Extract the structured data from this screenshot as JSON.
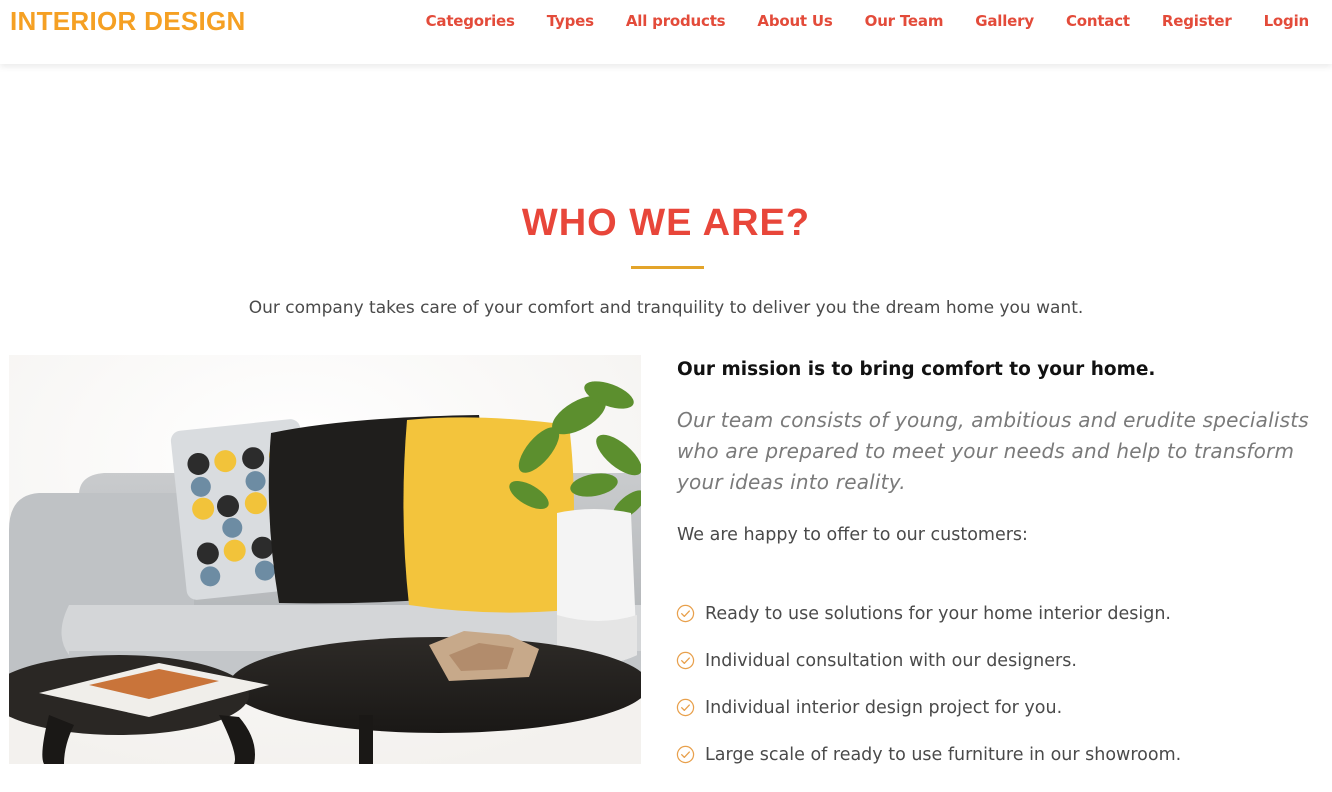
{
  "brand": {
    "name": "INTERIOR DESIGN",
    "color": "#f5a023"
  },
  "nav": {
    "color": "#e34b3a",
    "items": [
      {
        "label": "Categories"
      },
      {
        "label": "Types"
      },
      {
        "label": "All products"
      },
      {
        "label": "About Us"
      },
      {
        "label": "Our Team"
      },
      {
        "label": "Gallery"
      },
      {
        "label": "Contact"
      },
      {
        "label": "Register"
      },
      {
        "label": "Login"
      }
    ]
  },
  "about": {
    "title": "WHO WE ARE?",
    "title_color": "#e8463a",
    "rule_color": "#e3a42a",
    "intro": "Our company takes care of your comfort and tranquility to deliver you the dream home you want.",
    "mission": "Our mission is to bring comfort to your home.",
    "team": "Our team consists of young, ambitious and erudite specialists who are prepared to meet your needs and help to transform your ideas into reality.",
    "offer_heading": "We are happy to offer to our customers:",
    "benefits": [
      {
        "text": "Ready to use solutions for your home interior design.",
        "icon": "check-circle-icon"
      },
      {
        "text": "Individual consultation with our designers.",
        "icon": "check-circle-icon"
      },
      {
        "text": "Individual interior design project for you.",
        "icon": "check-circle-icon"
      },
      {
        "text": "Large scale of ready to use furniture in our showroom.",
        "icon": "check-circle-icon"
      }
    ],
    "photo": {
      "subject": "living-room-sofa-photo"
    }
  }
}
